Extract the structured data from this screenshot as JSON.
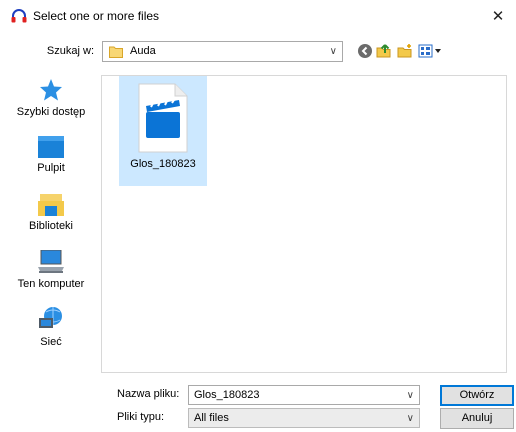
{
  "window": {
    "title": "Select one or more files",
    "close_glyph": "✕"
  },
  "lookin": {
    "label": "Szukaj w:",
    "value": "Auda"
  },
  "toolbar": {
    "icons": [
      "back-icon",
      "up-folder-icon",
      "new-folder-icon",
      "view-menu-icon"
    ]
  },
  "places": [
    {
      "label": "Szybki dostęp",
      "icon": "star-icon"
    },
    {
      "label": "Pulpit",
      "icon": "desktop-icon"
    },
    {
      "label": "Biblioteki",
      "icon": "libraries-icon"
    },
    {
      "label": "Ten komputer",
      "icon": "computer-icon"
    },
    {
      "label": "Sieć",
      "icon": "network-icon"
    }
  ],
  "files": [
    {
      "name": "Glos_180823",
      "icon": "video-file-icon",
      "selected": true
    }
  ],
  "filename": {
    "label": "Nazwa pliku:",
    "value": "Glos_180823"
  },
  "filetype": {
    "label": "Pliki typu:",
    "value": "All files"
  },
  "buttons": {
    "open": "Otwórz",
    "cancel": "Anuluj"
  },
  "colors": {
    "accent": "#0078d7",
    "selection": "#cce8ff",
    "icon_blue": "#0b74d6"
  }
}
